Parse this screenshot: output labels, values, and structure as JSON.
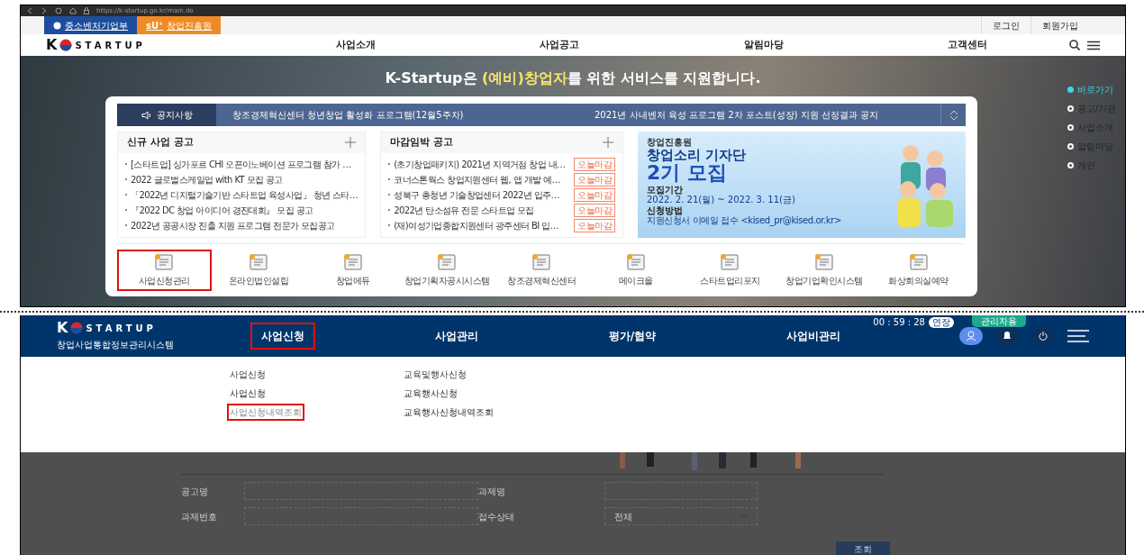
{
  "browser": {
    "url": "https://k-startup.go.kr/main.do"
  },
  "top_strip": {
    "links": [
      {
        "label": "중소벤처기업부"
      },
      {
        "mark": "sU⁺",
        "label": "창업진흥원"
      }
    ],
    "account_links": [
      "로그인",
      "회원가입"
    ]
  },
  "site_nav": {
    "logo_letter": "K",
    "logo_text": "STARTUP",
    "menu": [
      "사업소개",
      "사업공고",
      "알림마당",
      "고객센터"
    ]
  },
  "hero": {
    "headline": "K-Startup은 **(예비)창업자**를 위한 서비스를 지원합니다.",
    "notice": {
      "label": "공지사항",
      "items": [
        "창조경제혁신센터 청년창업 활성화 프로그램(12월5주차)",
        "2021년 사내벤처 육성 프로그램 2차 포스트(성장) 지원 선정결과 공지"
      ]
    },
    "new_notices": {
      "title": "신규 사업 공고",
      "items": [
        "[스타트업] 싱가포르 CHI 오픈이노베이션 프로그램 참가 …",
        "2022 글로벌스케일업 with KT 모집 공고",
        "「2022년 디지털기술기반 스타트업 육성사업」 청년 스타…",
        "『2022 DC 창업 아이디어 경진대회』 모집 공고",
        "2022년 공공시장 진출 지원 프로그램 전문가 모집공고"
      ]
    },
    "closing_notices": {
      "title": "마감임박 공고",
      "items": [
        {
          "text": "(초기창업패키지) 2021년 지역거점 창업 내…",
          "tag": "오늘마감"
        },
        {
          "text": "코너스톤웍스 창업지원센터 웹, 앱 개발 예…",
          "tag": "오늘마감"
        },
        {
          "text": "성북구 총청년 기술창업센터 2022년 입주…",
          "tag": "오늘마감"
        },
        {
          "text": "2022년 탄소섬유 전문 스타트업 모집",
          "tag": "오늘마감"
        },
        {
          "text": "(재)여성기업종합지원센터 광주센터 BI 입…",
          "tag": "오늘마감"
        }
      ]
    },
    "banner": {
      "sponsor": "창업진흥원",
      "title": "창업소리 기자단",
      "subtitle": "2기 모집",
      "period_label": "모집기간",
      "period": "2022. 2. 21(월) ~ 2022. 3. 11(금)",
      "method_label": "신청방법",
      "method": "지원신청서 이메일 접수 <kised_pr@kised.or.kr>"
    },
    "quick_links": [
      {
        "label": "사업신청관리",
        "selected": true
      },
      {
        "label": "온라인법인설립",
        "selected": false
      },
      {
        "label": "창업에듀",
        "selected": false
      },
      {
        "label": "창업기획자공시시스템",
        "selected": false
      },
      {
        "label": "창조경제혁신센터",
        "selected": false
      },
      {
        "label": "메이크올",
        "selected": false
      },
      {
        "label": "스타트업리포지",
        "selected": false
      },
      {
        "label": "창업기업확인시스템",
        "selected": false
      },
      {
        "label": "화상회의실예약",
        "selected": false
      }
    ],
    "side_nav": [
      {
        "label": "바로가기",
        "selected": true
      },
      {
        "label": "공고/기관",
        "selected": false
      },
      {
        "label": "사업소개",
        "selected": false
      },
      {
        "label": "알림마당",
        "selected": false
      },
      {
        "label": "개인",
        "selected": false
      }
    ]
  },
  "system": {
    "logo_letter": "K",
    "logo_text": "STARTUP",
    "subtitle": "창업사업통합정보관리시스템",
    "menu": [
      {
        "label": "사업신청",
        "selected": true
      },
      {
        "label": "사업관리",
        "selected": false
      },
      {
        "label": "평가/협약",
        "selected": false
      },
      {
        "label": "사업비관리",
        "selected": false
      }
    ],
    "timer": "00 : 59 : 28",
    "extend": "연장",
    "admin_badge": "관리자용",
    "dropdown": [
      {
        "heading": "사업신청",
        "items": [
          {
            "label": "사업신청",
            "selected": false
          },
          {
            "label": "사업신청내역조회",
            "selected": true
          }
        ]
      },
      {
        "heading": "교육및행사신청",
        "items": [
          {
            "label": "교육행사신청",
            "selected": false
          },
          {
            "label": "교육행사신청내역조회",
            "selected": false
          }
        ]
      }
    ],
    "form": {
      "fields": [
        {
          "label": "공고명",
          "kind": "text"
        },
        {
          "label": "과제명",
          "kind": "text"
        },
        {
          "label": "과제번호",
          "kind": "text"
        },
        {
          "label": "접수상태",
          "kind": "select",
          "value": "전체"
        }
      ],
      "button": "조회"
    }
  }
}
